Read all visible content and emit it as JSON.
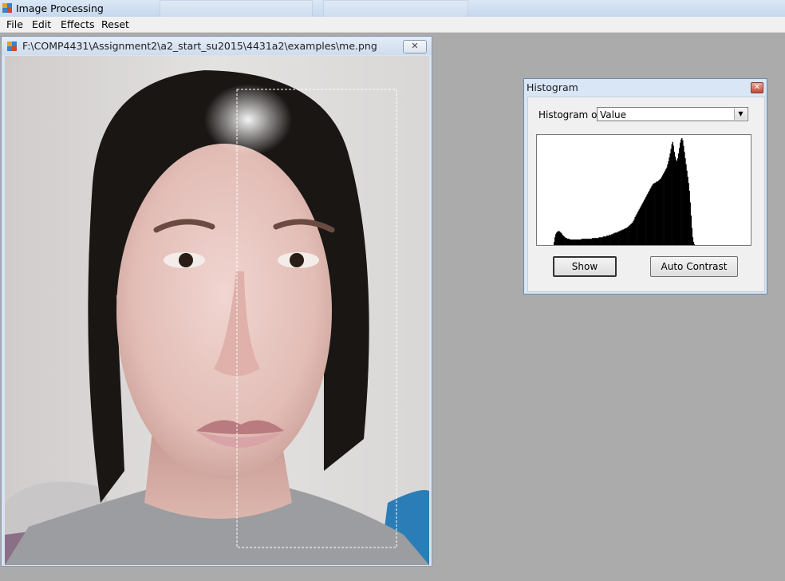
{
  "app": {
    "title": "Image Processing"
  },
  "menu": {
    "items": [
      "File",
      "Edit",
      "Effects",
      "Reset"
    ]
  },
  "image_window": {
    "path": "F:\\COMP4431\\Assignment2\\a2_start_su2015\\4431a2\\examples\\me.png",
    "close_glyph": "✕"
  },
  "histogram_window": {
    "title": "Histogram",
    "close_glyph": "✕",
    "histogram_of_label": "Histogram of:",
    "histogram_of_value": "Value",
    "dropdown_arrow": "▼",
    "show_button": "Show",
    "auto_contrast_button": "Auto Contrast"
  },
  "chart_data": {
    "type": "area",
    "bins": 256,
    "values": [
      0,
      0,
      0,
      0,
      0,
      0,
      0,
      0,
      0,
      0,
      0,
      0,
      0,
      0,
      0,
      0,
      0,
      0,
      0,
      0,
      4,
      10,
      14,
      16,
      17,
      18,
      18,
      17,
      16,
      15,
      13,
      12,
      11,
      10,
      9,
      9,
      8,
      8,
      8,
      7,
      7,
      7,
      7,
      7,
      7,
      7,
      7,
      7,
      7,
      7,
      7,
      7,
      7,
      8,
      8,
      8,
      8,
      8,
      8,
      8,
      8,
      8,
      8,
      8,
      8,
      8,
      9,
      9,
      9,
      9,
      9,
      9,
      9,
      9,
      10,
      10,
      10,
      10,
      10,
      11,
      11,
      11,
      11,
      12,
      12,
      12,
      13,
      13,
      13,
      14,
      14,
      15,
      15,
      16,
      16,
      16,
      17,
      17,
      18,
      18,
      19,
      19,
      20,
      20,
      21,
      21,
      22,
      22,
      23,
      24,
      25,
      26,
      27,
      28,
      29,
      31,
      33,
      36,
      38,
      40,
      42,
      44,
      46,
      48,
      50,
      52,
      54,
      56,
      58,
      60,
      62,
      64,
      66,
      68,
      70,
      72,
      74,
      76,
      78,
      79,
      80,
      80,
      81,
      82,
      82,
      83,
      84,
      85,
      86,
      88,
      90,
      92,
      94,
      96,
      98,
      100,
      104,
      108,
      113,
      118,
      124,
      130,
      133,
      128,
      120,
      114,
      110,
      108,
      112,
      118,
      125,
      132,
      136,
      138,
      135,
      128,
      120,
      112,
      104,
      96,
      88,
      80,
      70,
      55,
      38,
      22,
      10,
      4,
      1,
      0,
      0,
      0,
      0,
      0,
      0,
      0,
      0,
      0,
      0,
      0,
      0,
      0,
      0,
      0,
      0,
      0,
      0,
      0,
      0,
      0,
      0,
      0,
      0,
      0,
      0,
      0,
      0,
      0,
      0,
      0,
      0,
      0,
      0,
      0,
      0,
      0,
      0,
      0,
      0,
      0,
      0,
      0,
      0,
      0,
      0,
      0,
      0,
      0,
      0,
      0,
      0,
      0,
      0,
      0,
      0,
      0,
      0,
      0,
      0,
      0,
      0,
      0,
      0,
      0,
      0,
      0
    ],
    "ylim": [
      0,
      140
    ],
    "fill": "#000000",
    "background": "#ffffff"
  },
  "colors": {
    "workspace": "#ababab",
    "titlebar": "#d2e0f1",
    "dialog_frame": "#d9e6f5"
  }
}
